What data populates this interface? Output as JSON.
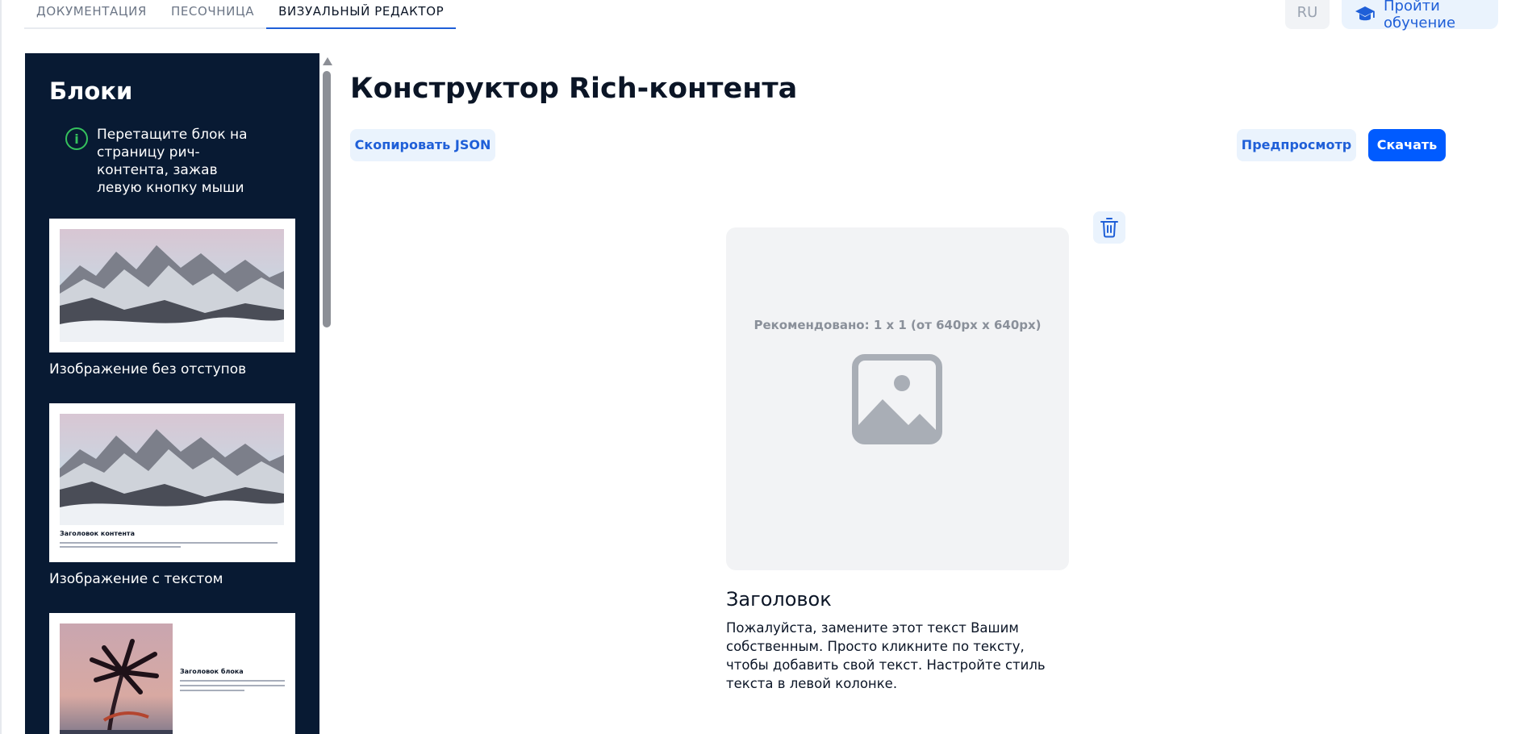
{
  "tabs": [
    {
      "label": "ДОКУМЕНТАЦИЯ",
      "active": false
    },
    {
      "label": "ПЕСОЧНИЦА",
      "active": false
    },
    {
      "label": "ВИЗУАЛЬНЫЙ РЕДАКТОР",
      "active": true
    }
  ],
  "header": {
    "lang": "RU",
    "learn_label": "Пройти обучение",
    "learn_icon": "graduation-cap-icon"
  },
  "sidebar": {
    "title": "Блоки",
    "hint": "Перетащите блок на страницу рич-контента, зажав левую кнопку мыши",
    "blocks": [
      {
        "label": "Изображение без отступов"
      },
      {
        "label": "Изображение с текстом",
        "preview_title": "Заголовок контента"
      },
      {
        "preview_title": "Заголовок блока"
      }
    ]
  },
  "main": {
    "title": "Конструктор Rich-контента",
    "copy_json_label": "Скопировать JSON",
    "preview_label": "Предпросмотр",
    "download_label": "Скачать",
    "placeholder_recommendation": "Рекомендовано: 1 x 1 (от 640px x 640px)",
    "block_heading": "Заголовок",
    "block_body": "Пожалуйста, замените этот текст Вашим собственным. Просто кликните по тексту, чтобы добавить свой текст. Настройте стиль текста в левой колонке."
  },
  "colors": {
    "sidebar_bg": "#081a33",
    "accent": "#005bff",
    "accent_light": "#eaf3fd",
    "success": "#35c15d"
  }
}
